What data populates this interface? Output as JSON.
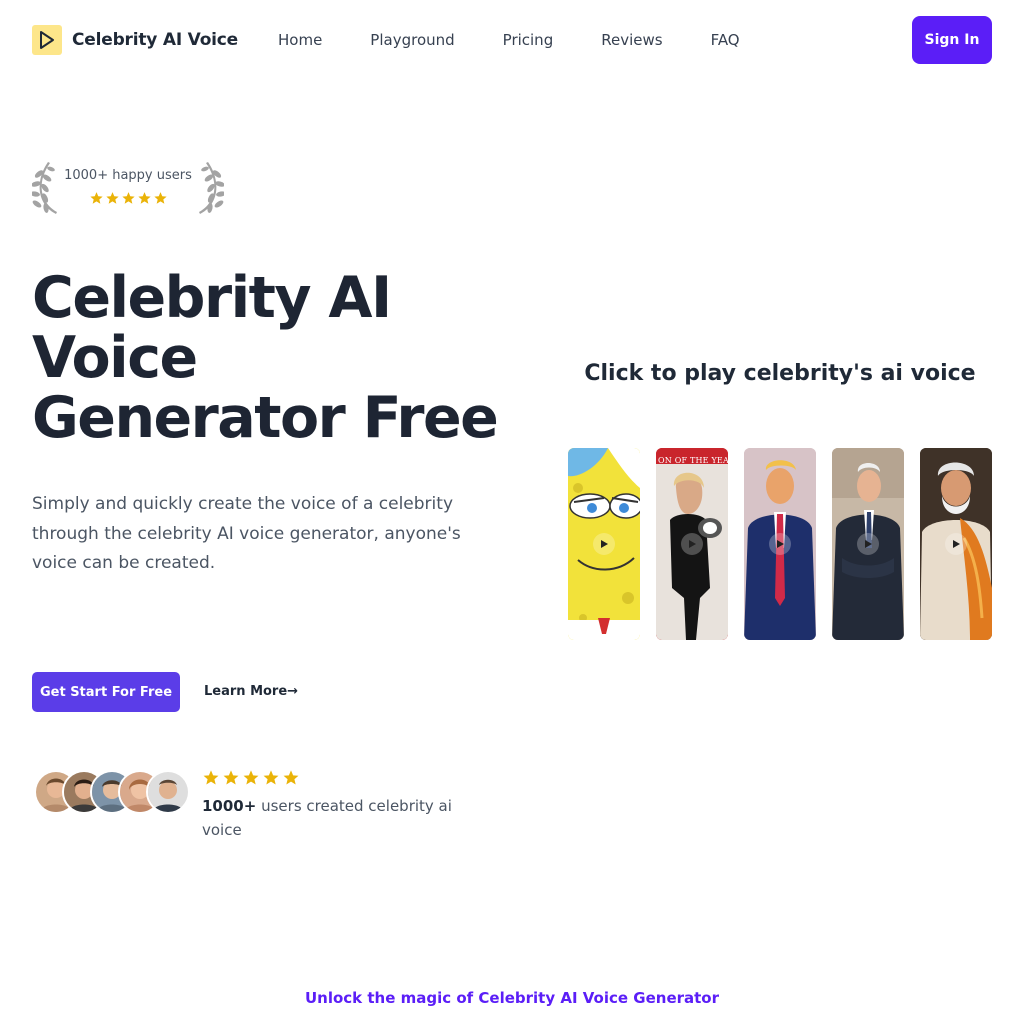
{
  "brand": {
    "name": "Celebrity AI Voice",
    "logo_icon": "play-icon",
    "logo_bg": "#fde68a"
  },
  "nav": {
    "links": [
      "Home",
      "Playground",
      "Pricing",
      "Reviews",
      "FAQ"
    ],
    "signin_label": "Sign In"
  },
  "badge": {
    "text": "1000+ happy users",
    "stars": 5,
    "icon": "laurel-icon"
  },
  "hero": {
    "title": "Celebrity AI Voice Generator Free",
    "description": "Simply and quickly create the voice of a celebrity through the celebrity AI voice generator, anyone's voice can be created.",
    "primary_cta": "Get Start For Free",
    "secondary_cta": "Learn More→"
  },
  "social_proof": {
    "stars": 5,
    "count": "1000+",
    "text": " users created celebrity ai voice",
    "avatar_count": 5
  },
  "panel": {
    "title": "Click to play celebrity's ai voice",
    "cards": [
      {
        "name": "spongebob-card",
        "icon": "play-icon"
      },
      {
        "name": "taylor-card",
        "icon": "play-icon",
        "caption": "ON OF THE YEAR"
      },
      {
        "name": "trump-card",
        "icon": "play-icon"
      },
      {
        "name": "biden-card",
        "icon": "play-icon"
      },
      {
        "name": "modi-card",
        "icon": "play-icon"
      }
    ]
  },
  "teaser": {
    "text": "Unlock the magic of Celebrity AI Voice Generator"
  },
  "colors": {
    "accent": "#5b1ef7",
    "cta": "#5b3de8",
    "star": "#eab308",
    "laurel": "#9ca3af"
  }
}
